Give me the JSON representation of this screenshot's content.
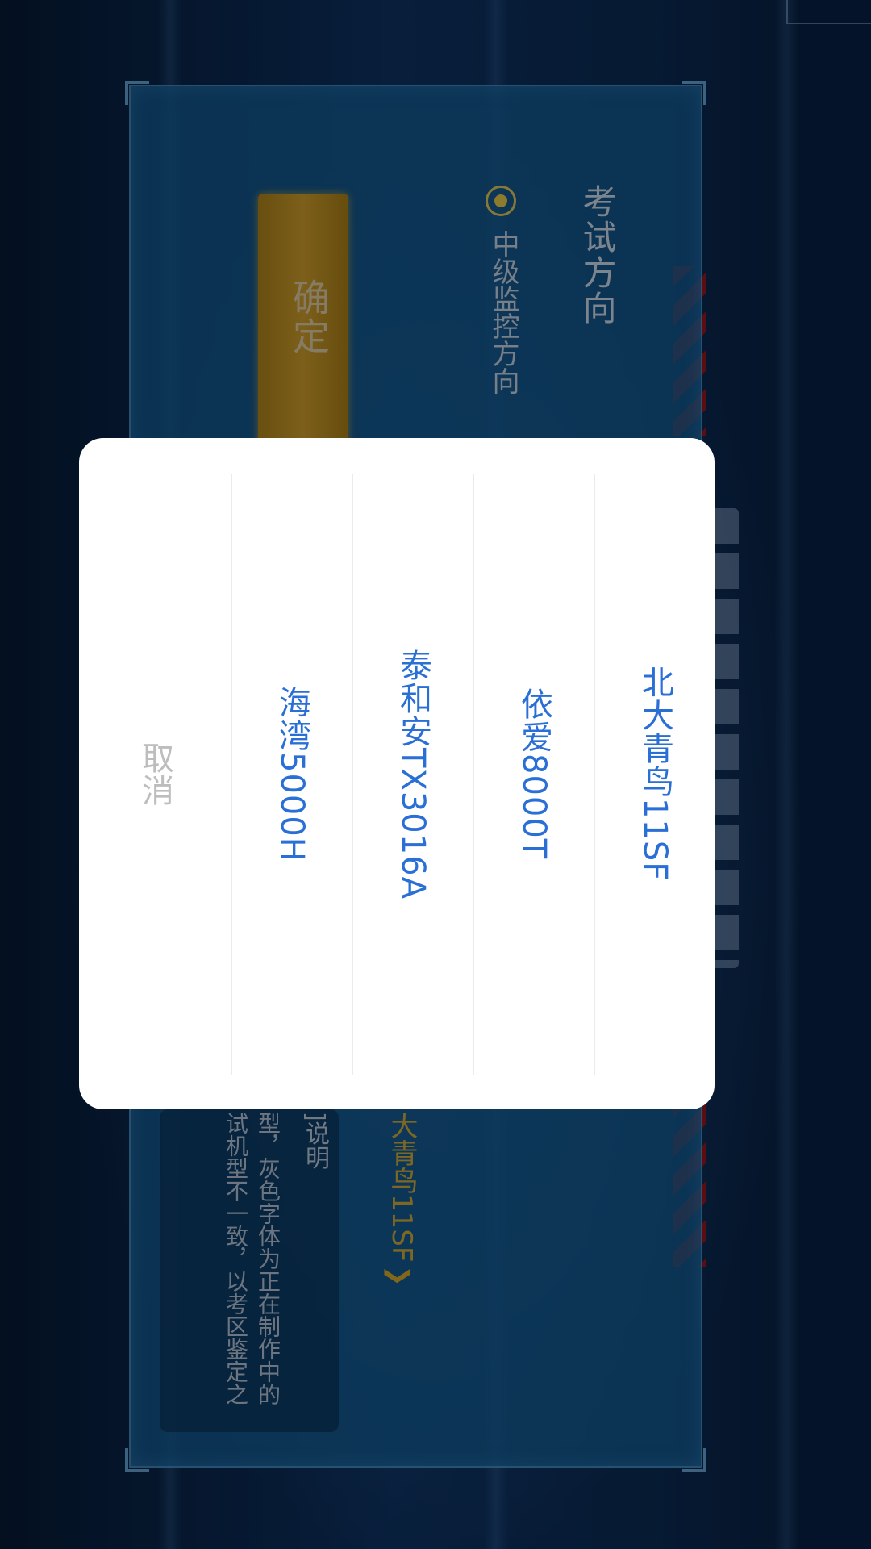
{
  "background": {
    "exam_direction_title": "考试方向",
    "exam_direction_option": "中级监控方向",
    "confirm_button_label": "确定",
    "selected_model": "大青鸟11SF",
    "notes_title": "]说明",
    "notes_line1": "型，灰色字体为正在制作中的",
    "notes_line2": "试机型不一致，以考区鉴定之"
  },
  "action_sheet": {
    "options": [
      {
        "label": "北大青鸟11SF"
      },
      {
        "label": "依爱8000T"
      },
      {
        "label": "泰和安TX3016A"
      },
      {
        "label": "海湾5000H"
      }
    ],
    "cancel_label": "取消"
  },
  "colors": {
    "option_text": "#2a6fd6",
    "cancel_text": "#bdbdbd",
    "accent_gold": "#c89a2a"
  }
}
